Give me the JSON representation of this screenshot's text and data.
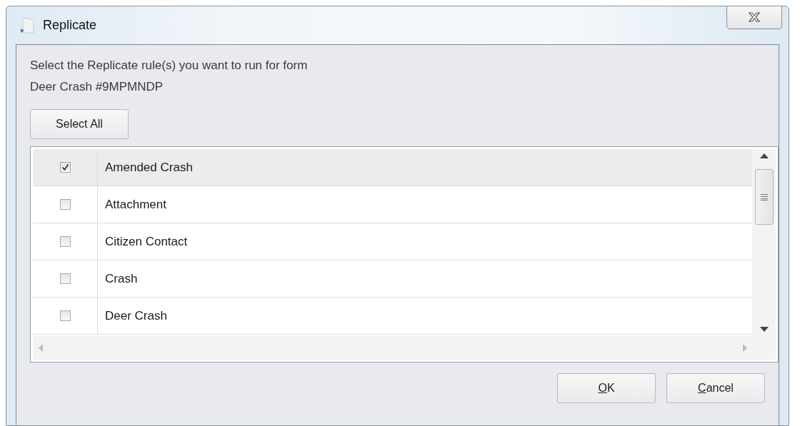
{
  "window": {
    "title": "Replicate"
  },
  "prompt": [
    "Select the Replicate rule(s) you want to run for form",
    "Deer Crash #9MPMNDP"
  ],
  "select_all_button": "Select All",
  "rules": [
    {
      "label": "Amended Crash",
      "checked": true,
      "selected": true
    },
    {
      "label": "Attachment",
      "checked": false,
      "selected": false
    },
    {
      "label": "Citizen Contact",
      "checked": false,
      "selected": false
    },
    {
      "label": "Crash",
      "checked": false,
      "selected": false
    },
    {
      "label": "Deer Crash",
      "checked": false,
      "selected": false
    }
  ],
  "buttons": [
    {
      "label": "OK",
      "first_letter_underlined": true
    },
    {
      "label": "Cancel",
      "first_letter_underlined": true
    }
  ]
}
